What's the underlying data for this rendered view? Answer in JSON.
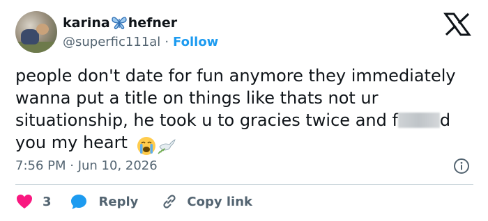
{
  "author": {
    "name_part1": "karina",
    "name_part2": "hefner",
    "handle": "@superfic111al",
    "separator": "·",
    "follow_label": "Follow"
  },
  "tweet": {
    "text_line1": "people don't date for fun anymore they immediately wanna put a title on things like thats not ur situationship, he took u to gracies twice and f",
    "text_line2": "d you my heart",
    "emojis": [
      "loudly-crying-face",
      "dove"
    ]
  },
  "meta": {
    "timestamp": "7:56 PM · Jun 10, 2026"
  },
  "actions": {
    "like_count": "3",
    "reply_label": "Reply",
    "copy_link_label": "Copy link"
  },
  "colors": {
    "link": "#1d9bf0",
    "secondary_text": "#536471",
    "heart": "#f91880",
    "reply_bubble": "#1d9bf0",
    "divider": "#cfd9de"
  },
  "icons": [
    "butterfly-icon",
    "x-logo-icon",
    "info-icon",
    "heart-icon",
    "reply-icon",
    "link-icon"
  ]
}
